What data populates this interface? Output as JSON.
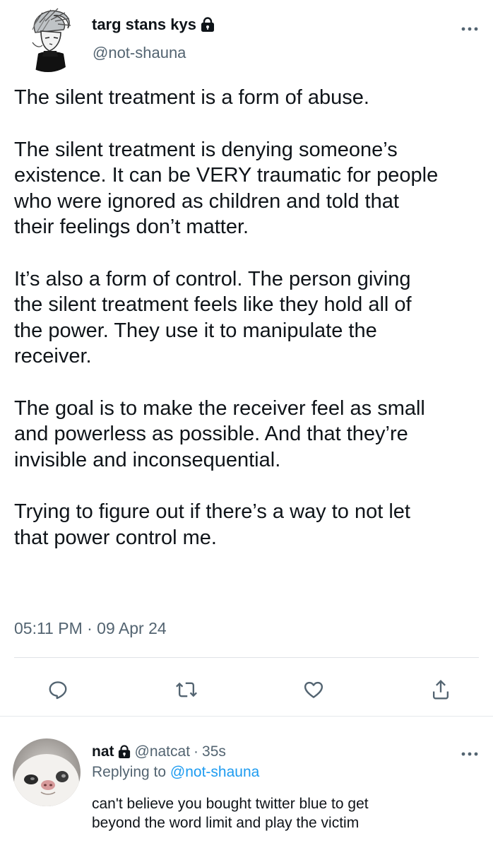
{
  "tweet": {
    "author": {
      "display_name": "targ stans kys",
      "handle": "@not-shauna",
      "protected_icon": "lock-icon",
      "avatar": "avatar-icon"
    },
    "paragraphs": [
      [
        "The silent treatment is a form of abuse."
      ],
      [
        "The silent treatment is denying someone’s",
        "existence. It can be VERY traumatic for people",
        "who were ignored as children and told that",
        "their feelings don’t matter."
      ],
      [
        "It’s also a form of control. The person giving",
        "the silent treatment feels like they hold all of",
        "the power. They use it to manipulate the",
        "receiver."
      ],
      [
        "The goal is to make the receiver feel as small",
        "and powerless as possible. And that they’re",
        "invisible and inconsequential."
      ],
      [
        "Trying to figure out if there’s a way to not let",
        "that power control me."
      ]
    ],
    "timestamp": "05:11 PM · 09 Apr 24",
    "actions": [
      {
        "name": "reply",
        "icon": "reply-icon"
      },
      {
        "name": "retweet",
        "icon": "retweet-icon"
      },
      {
        "name": "like",
        "icon": "heart-icon"
      },
      {
        "name": "share",
        "icon": "share-icon"
      }
    ],
    "more_icon": "more-icon"
  },
  "reply": {
    "author": {
      "display_name": "nat",
      "handle": "@natcat",
      "time_sep": "·",
      "time": "35s",
      "protected_icon": "lock-icon",
      "avatar": "cat-avatar-icon"
    },
    "replying_label": "Replying to",
    "replying_to": "@not-shauna",
    "text": [
      "can't believe you bought twitter blue to get",
      "beyond the word limit and play the victim"
    ]
  },
  "colors": {
    "text": "#0f1419",
    "secondary": "#536471",
    "link": "#1d9bf0",
    "divider": "#dfe3e6"
  }
}
